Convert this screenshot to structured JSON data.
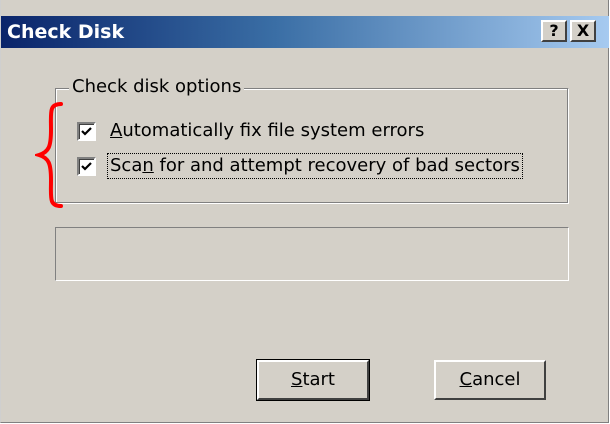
{
  "window": {
    "title": "Check Disk",
    "help_button": "?",
    "close_button": "X"
  },
  "options": {
    "group_label": "Check disk options",
    "items": [
      {
        "mnemonic": "A",
        "rest": "utomatically fix file system errors",
        "checked": true
      },
      {
        "before": "Sca",
        "mnemonic": "n",
        "rest": " for and attempt recovery of bad sectors",
        "checked": true
      }
    ]
  },
  "progress": {
    "value": 0
  },
  "buttons": {
    "start": {
      "mnemonic": "S",
      "rest": "tart"
    },
    "cancel": {
      "mnemonic": "C",
      "rest": "ancel"
    }
  },
  "colors": {
    "title_bar_start": "#0a246a",
    "title_bar_end": "#a6caf0",
    "dialog_face": "#d4d0c8",
    "annotation_brace": "#ff0000"
  }
}
